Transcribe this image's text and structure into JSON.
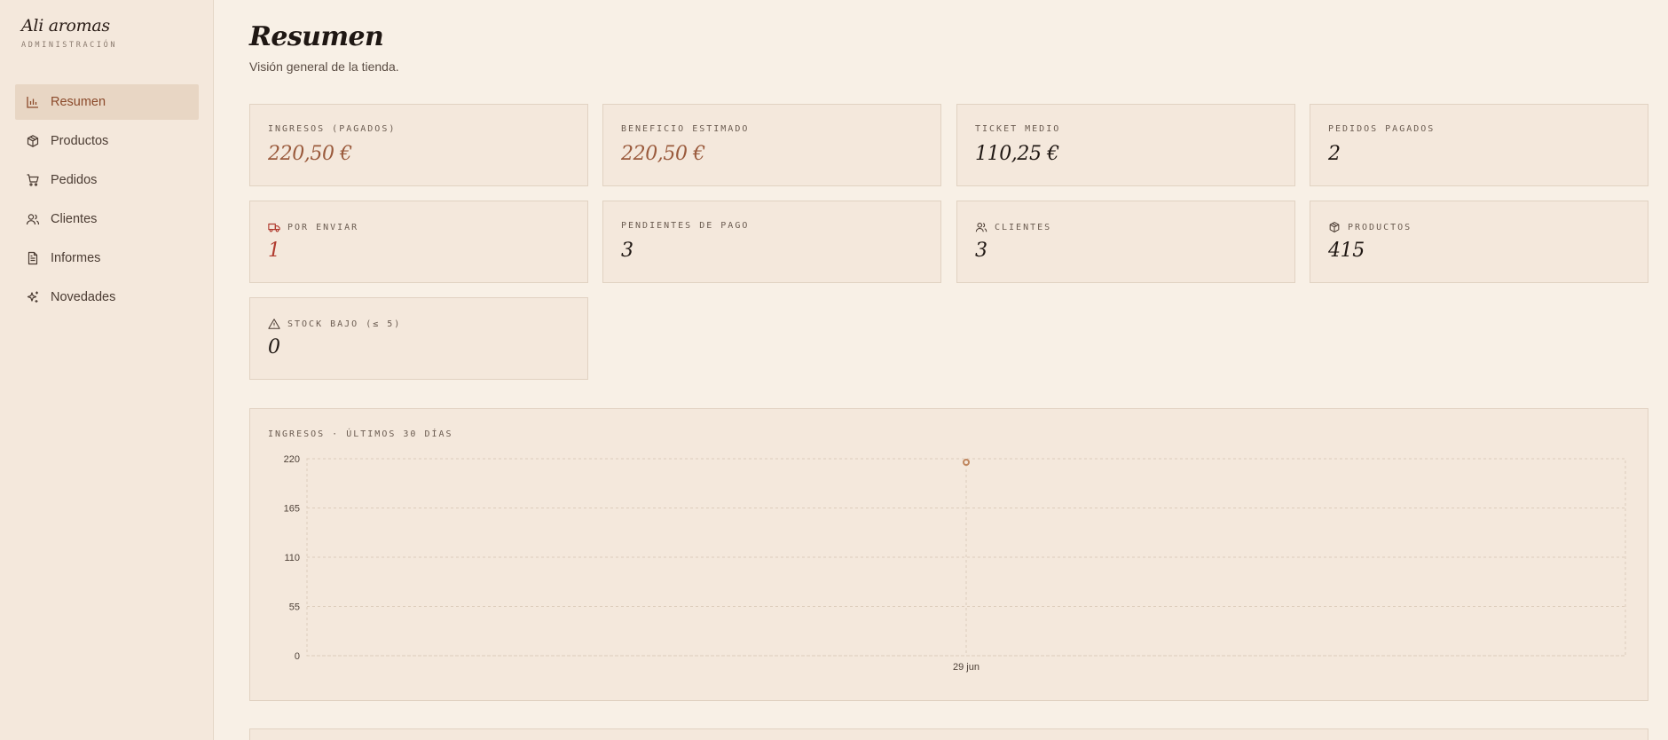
{
  "brand": {
    "name": "Ali aromas",
    "subtitle": "ADMINISTRACIÓN"
  },
  "sidebar": {
    "items": [
      {
        "label": "Resumen",
        "icon": "bar-chart-icon",
        "active": true
      },
      {
        "label": "Productos",
        "icon": "box-icon",
        "active": false
      },
      {
        "label": "Pedidos",
        "icon": "cart-icon",
        "active": false
      },
      {
        "label": "Clientes",
        "icon": "users-icon",
        "active": false
      },
      {
        "label": "Informes",
        "icon": "document-icon",
        "active": false
      },
      {
        "label": "Novedades",
        "icon": "sparkles-icon",
        "active": false
      }
    ]
  },
  "page": {
    "title": "Resumen",
    "subtitle": "Visión general de la tienda."
  },
  "stats": [
    {
      "label": "INGRESOS (PAGADOS)",
      "value": "220,50 €",
      "icon": null
    },
    {
      "label": "BENEFICIO ESTIMADO",
      "value": "220,50 €",
      "icon": null
    },
    {
      "label": "TICKET MEDIO",
      "value": "110,25 €",
      "icon": null
    },
    {
      "label": "PEDIDOS PAGADOS",
      "value": "2",
      "icon": null
    },
    {
      "label": "POR ENVIAR",
      "value": "1",
      "icon": "truck-icon"
    },
    {
      "label": "PENDIENTES DE PAGO",
      "value": "3",
      "icon": null
    },
    {
      "label": "CLIENTES",
      "value": "3",
      "icon": "users-icon"
    },
    {
      "label": "PRODUCTOS",
      "value": "415",
      "icon": "box-icon"
    },
    {
      "label": "STOCK BAJO (≤ 5)",
      "value": "0",
      "icon": "warning-icon"
    }
  ],
  "colors": {
    "accent": "#9a5a3c",
    "alert": "#b03a2e",
    "background": "#f8f0e6",
    "card": "#f4e8dc"
  },
  "chart_data": {
    "type": "line",
    "title": "INGRESOS · ÚLTIMOS 30 DÍAS",
    "x": [
      "29 jun"
    ],
    "series": [
      {
        "values": [
          220.5
        ]
      }
    ],
    "ylim": [
      0,
      220
    ],
    "yticks": [
      0,
      55,
      110,
      165,
      220
    ],
    "grid": true,
    "color": "#c0875f"
  }
}
